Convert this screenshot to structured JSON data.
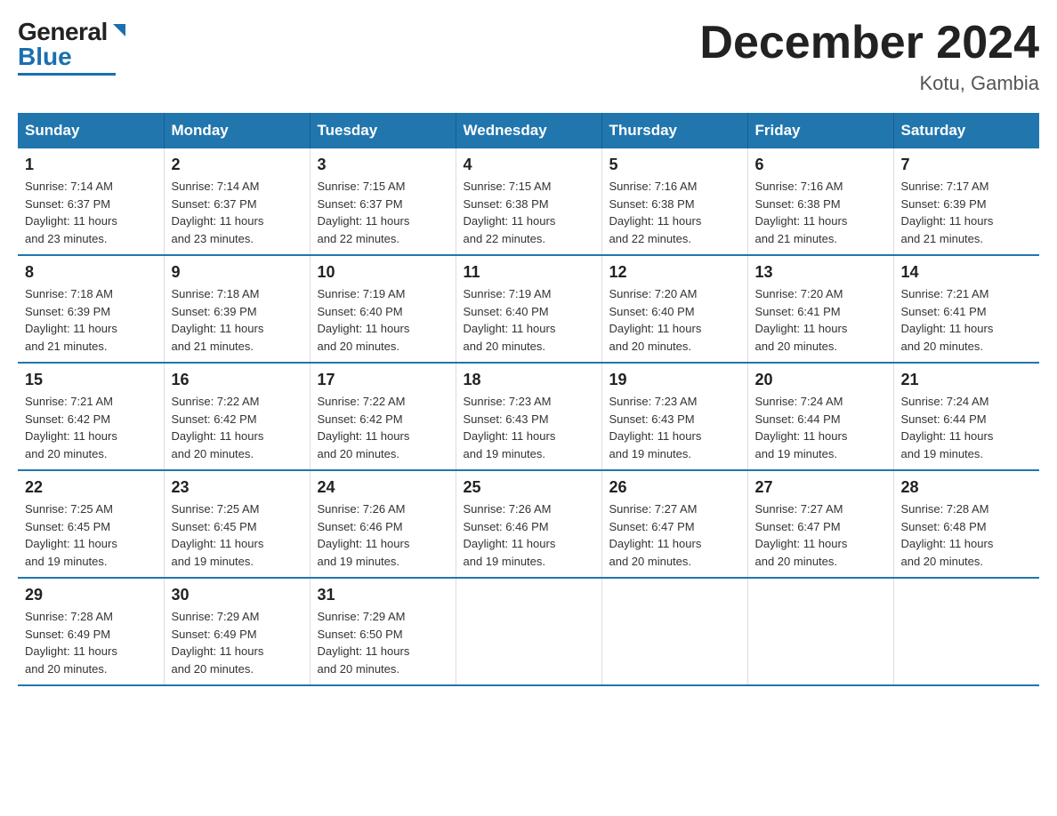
{
  "logo": {
    "general": "General",
    "blue": "Blue"
  },
  "title": "December 2024",
  "subtitle": "Kotu, Gambia",
  "header_days": [
    "Sunday",
    "Monday",
    "Tuesday",
    "Wednesday",
    "Thursday",
    "Friday",
    "Saturday"
  ],
  "weeks": [
    [
      {
        "day": "1",
        "sunrise": "7:14 AM",
        "sunset": "6:37 PM",
        "daylight": "11 hours and 23 minutes."
      },
      {
        "day": "2",
        "sunrise": "7:14 AM",
        "sunset": "6:37 PM",
        "daylight": "11 hours and 23 minutes."
      },
      {
        "day": "3",
        "sunrise": "7:15 AM",
        "sunset": "6:37 PM",
        "daylight": "11 hours and 22 minutes."
      },
      {
        "day": "4",
        "sunrise": "7:15 AM",
        "sunset": "6:38 PM",
        "daylight": "11 hours and 22 minutes."
      },
      {
        "day": "5",
        "sunrise": "7:16 AM",
        "sunset": "6:38 PM",
        "daylight": "11 hours and 22 minutes."
      },
      {
        "day": "6",
        "sunrise": "7:16 AM",
        "sunset": "6:38 PM",
        "daylight": "11 hours and 21 minutes."
      },
      {
        "day": "7",
        "sunrise": "7:17 AM",
        "sunset": "6:39 PM",
        "daylight": "11 hours and 21 minutes."
      }
    ],
    [
      {
        "day": "8",
        "sunrise": "7:18 AM",
        "sunset": "6:39 PM",
        "daylight": "11 hours and 21 minutes."
      },
      {
        "day": "9",
        "sunrise": "7:18 AM",
        "sunset": "6:39 PM",
        "daylight": "11 hours and 21 minutes."
      },
      {
        "day": "10",
        "sunrise": "7:19 AM",
        "sunset": "6:40 PM",
        "daylight": "11 hours and 20 minutes."
      },
      {
        "day": "11",
        "sunrise": "7:19 AM",
        "sunset": "6:40 PM",
        "daylight": "11 hours and 20 minutes."
      },
      {
        "day": "12",
        "sunrise": "7:20 AM",
        "sunset": "6:40 PM",
        "daylight": "11 hours and 20 minutes."
      },
      {
        "day": "13",
        "sunrise": "7:20 AM",
        "sunset": "6:41 PM",
        "daylight": "11 hours and 20 minutes."
      },
      {
        "day": "14",
        "sunrise": "7:21 AM",
        "sunset": "6:41 PM",
        "daylight": "11 hours and 20 minutes."
      }
    ],
    [
      {
        "day": "15",
        "sunrise": "7:21 AM",
        "sunset": "6:42 PM",
        "daylight": "11 hours and 20 minutes."
      },
      {
        "day": "16",
        "sunrise": "7:22 AM",
        "sunset": "6:42 PM",
        "daylight": "11 hours and 20 minutes."
      },
      {
        "day": "17",
        "sunrise": "7:22 AM",
        "sunset": "6:42 PM",
        "daylight": "11 hours and 20 minutes."
      },
      {
        "day": "18",
        "sunrise": "7:23 AM",
        "sunset": "6:43 PM",
        "daylight": "11 hours and 19 minutes."
      },
      {
        "day": "19",
        "sunrise": "7:23 AM",
        "sunset": "6:43 PM",
        "daylight": "11 hours and 19 minutes."
      },
      {
        "day": "20",
        "sunrise": "7:24 AM",
        "sunset": "6:44 PM",
        "daylight": "11 hours and 19 minutes."
      },
      {
        "day": "21",
        "sunrise": "7:24 AM",
        "sunset": "6:44 PM",
        "daylight": "11 hours and 19 minutes."
      }
    ],
    [
      {
        "day": "22",
        "sunrise": "7:25 AM",
        "sunset": "6:45 PM",
        "daylight": "11 hours and 19 minutes."
      },
      {
        "day": "23",
        "sunrise": "7:25 AM",
        "sunset": "6:45 PM",
        "daylight": "11 hours and 19 minutes."
      },
      {
        "day": "24",
        "sunrise": "7:26 AM",
        "sunset": "6:46 PM",
        "daylight": "11 hours and 19 minutes."
      },
      {
        "day": "25",
        "sunrise": "7:26 AM",
        "sunset": "6:46 PM",
        "daylight": "11 hours and 19 minutes."
      },
      {
        "day": "26",
        "sunrise": "7:27 AM",
        "sunset": "6:47 PM",
        "daylight": "11 hours and 20 minutes."
      },
      {
        "day": "27",
        "sunrise": "7:27 AM",
        "sunset": "6:47 PM",
        "daylight": "11 hours and 20 minutes."
      },
      {
        "day": "28",
        "sunrise": "7:28 AM",
        "sunset": "6:48 PM",
        "daylight": "11 hours and 20 minutes."
      }
    ],
    [
      {
        "day": "29",
        "sunrise": "7:28 AM",
        "sunset": "6:49 PM",
        "daylight": "11 hours and 20 minutes."
      },
      {
        "day": "30",
        "sunrise": "7:29 AM",
        "sunset": "6:49 PM",
        "daylight": "11 hours and 20 minutes."
      },
      {
        "day": "31",
        "sunrise": "7:29 AM",
        "sunset": "6:50 PM",
        "daylight": "11 hours and 20 minutes."
      },
      null,
      null,
      null,
      null
    ]
  ],
  "labels": {
    "sunrise": "Sunrise:",
    "sunset": "Sunset:",
    "daylight": "Daylight:"
  }
}
